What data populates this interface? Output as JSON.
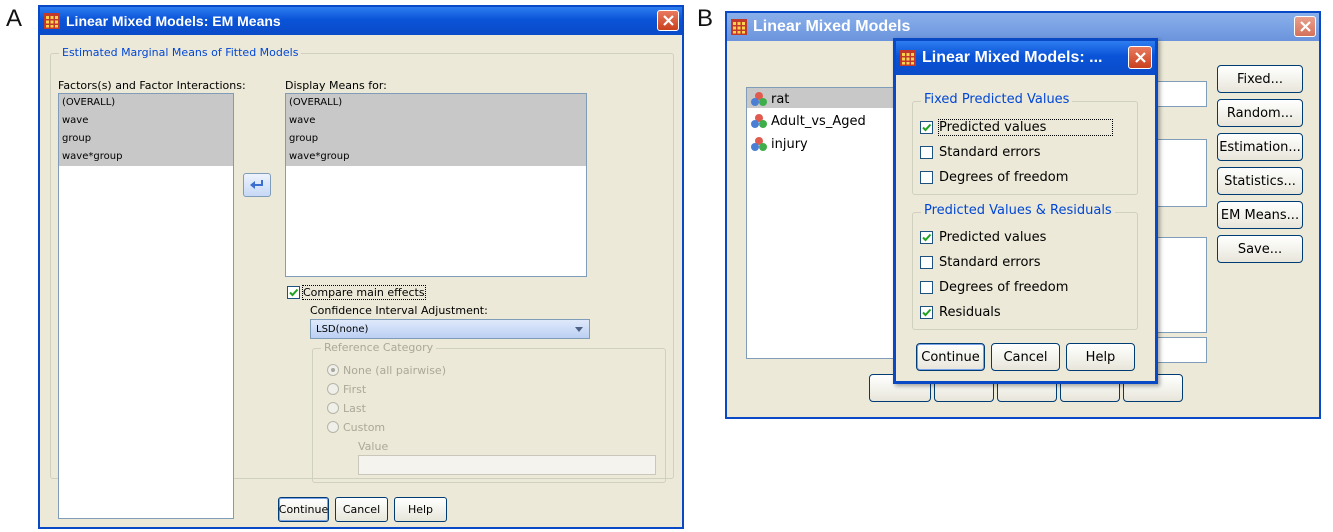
{
  "panels": {
    "a": "A",
    "b": "B"
  },
  "em": {
    "title": "Linear Mixed Models: EM Means",
    "group_label": "Estimated Marginal Means of Fitted Models",
    "factors_label": "Factors(s) and Factor Interactions:",
    "factors": [
      "(OVERALL)",
      "wave",
      "group",
      "wave*group"
    ],
    "display_label": "Display Means for:",
    "display": [
      "(OVERALL)",
      "wave",
      "group",
      "wave*group"
    ],
    "compare_label": "Compare main effects",
    "ci_label": "Confidence Interval Adjustment:",
    "ci_value": "LSD(none)",
    "ref_label": "Reference Category",
    "ref_options": [
      "None (all pairwise)",
      "First",
      "Last",
      "Custom"
    ],
    "value_label": "Value",
    "buttons": {
      "continue": "Continue",
      "cancel": "Cancel",
      "help": "Help"
    }
  },
  "lmm": {
    "title": "Linear Mixed Models",
    "variables": [
      "rat",
      "Adult_vs_Aged",
      "injury"
    ],
    "side_buttons": [
      "Fixed...",
      "Random...",
      "Estimation...",
      "Statistics...",
      "EM Means...",
      "Save..."
    ]
  },
  "save": {
    "title": "Linear Mixed Models: ...",
    "fixed_group": "Fixed Predicted Values",
    "fixed_items": [
      {
        "label": "Predicted values",
        "checked": true
      },
      {
        "label": "Standard errors",
        "checked": false
      },
      {
        "label": "Degrees of freedom",
        "checked": false
      }
    ],
    "resid_group": "Predicted Values & Residuals",
    "resid_items": [
      {
        "label": "Predicted values",
        "checked": true
      },
      {
        "label": "Standard errors",
        "checked": false
      },
      {
        "label": "Degrees of freedom",
        "checked": false
      },
      {
        "label": "Residuals",
        "checked": true
      }
    ],
    "buttons": {
      "continue": "Continue",
      "cancel": "Cancel",
      "help": "Help"
    }
  },
  "colors": {
    "title_blue": "#0a53d8",
    "close_red": "#d3502c",
    "accent_blue": "#0046d5"
  }
}
